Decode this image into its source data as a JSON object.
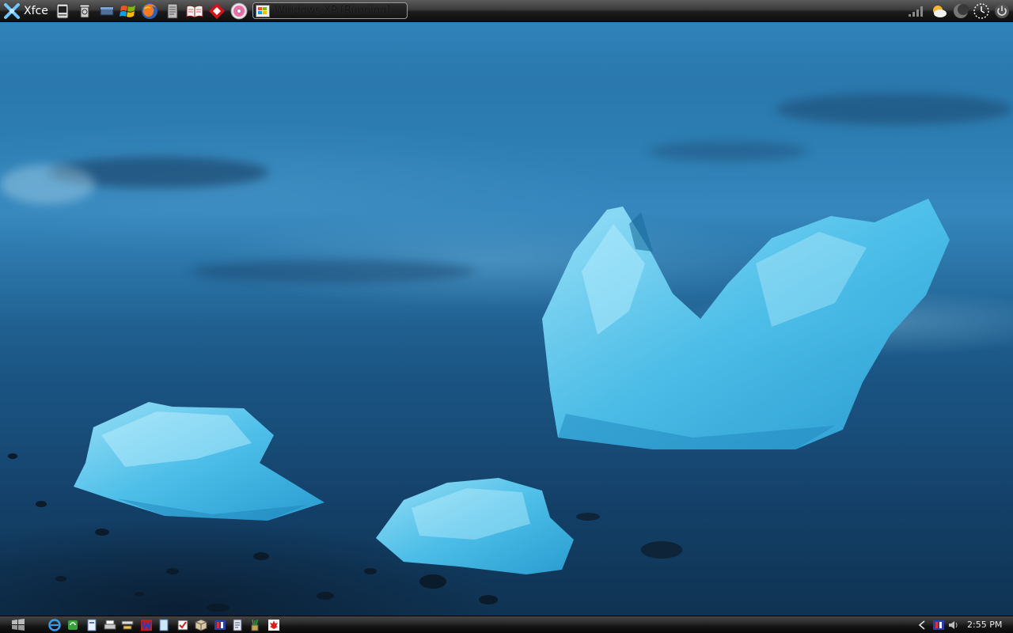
{
  "top_panel": {
    "menu_label": "Xfce",
    "launchers": [
      {
        "icon": "terminal-icon"
      },
      {
        "icon": "recycle-bin-icon"
      },
      {
        "icon": "show-desktop-icon"
      },
      {
        "icon": "windows-flag-icon"
      },
      {
        "icon": "firefox-icon"
      },
      {
        "icon": "text-editor-icon"
      },
      {
        "icon": "dictionary-icon"
      },
      {
        "icon": "diamond-app-icon"
      },
      {
        "icon": "cd-burner-icon"
      }
    ],
    "task": {
      "label": "Windows XP [Running]...",
      "icon": "virtualbox-windows-icon"
    },
    "tray": [
      {
        "icon": "signal-strength-icon"
      },
      {
        "icon": "weather-icon"
      },
      {
        "icon": "moon-icon"
      },
      {
        "icon": "analog-clock-icon"
      },
      {
        "icon": "power-icon"
      }
    ]
  },
  "bottom_panel": {
    "start_icon": "windows-start-icon",
    "quick_launch": [
      {
        "icon": "internet-explorer-icon"
      },
      {
        "icon": "recycle-icon"
      },
      {
        "icon": "documents-icon"
      },
      {
        "icon": "printer-icon"
      },
      {
        "icon": "network-icon"
      },
      {
        "icon": "word-icon"
      },
      {
        "icon": "notepad-icon"
      },
      {
        "icon": "checklist-icon"
      },
      {
        "icon": "package-icon"
      },
      {
        "icon": "media-icon"
      },
      {
        "icon": "document-icon"
      },
      {
        "icon": "pencil-cup-icon"
      },
      {
        "icon": "maple-leaf-icon"
      }
    ],
    "tray_icons": [
      {
        "icon": "chevron-left-icon"
      },
      {
        "icon": "media-player-icon"
      },
      {
        "icon": "volume-icon"
      }
    ],
    "clock": "2:55 PM"
  },
  "colors": {
    "panel_dark": "#141414",
    "ice_light": "#8fdaf5",
    "ice_mid": "#4cbde8",
    "sea": "#2a78ad"
  }
}
